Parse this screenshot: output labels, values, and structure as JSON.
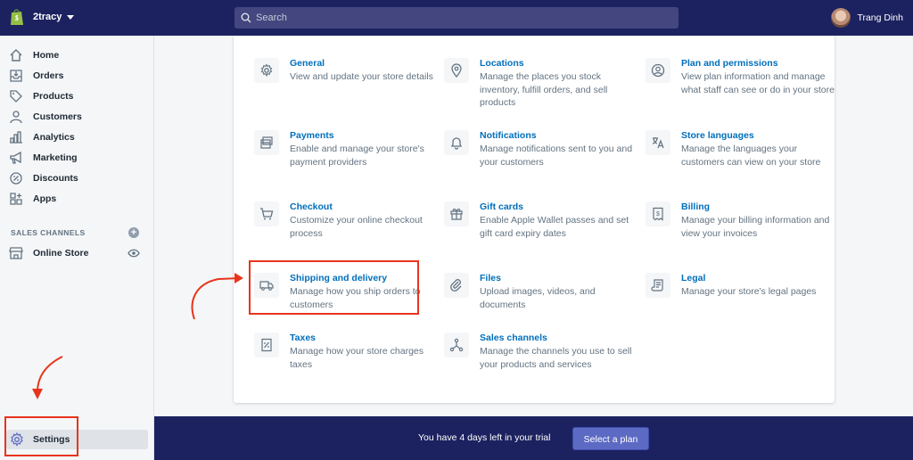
{
  "topbar": {
    "store_name": "2tracy",
    "search_placeholder": "Search",
    "user_name": "Trang Dinh"
  },
  "sidebar": {
    "items": [
      {
        "label": "Home",
        "icon": "home-icon"
      },
      {
        "label": "Orders",
        "icon": "orders-icon"
      },
      {
        "label": "Products",
        "icon": "tag-icon"
      },
      {
        "label": "Customers",
        "icon": "person-icon"
      },
      {
        "label": "Analytics",
        "icon": "bar-chart-icon"
      },
      {
        "label": "Marketing",
        "icon": "megaphone-icon"
      },
      {
        "label": "Discounts",
        "icon": "discount-icon"
      },
      {
        "label": "Apps",
        "icon": "apps-icon"
      }
    ],
    "sales_channels_heading": "SALES CHANNELS",
    "online_store_label": "Online Store",
    "settings_label": "Settings"
  },
  "settings": [
    {
      "title": "General",
      "desc": "View and update your store details",
      "icon": "gear-icon"
    },
    {
      "title": "Locations",
      "desc": "Manage the places you stock inventory, fulfill orders, and sell products",
      "icon": "location-pin-icon"
    },
    {
      "title": "Plan and permissions",
      "desc": "View plan information and manage what staff can see or do in your store",
      "icon": "user-circle-icon"
    },
    {
      "title": "Payments",
      "desc": "Enable and manage your store's payment providers",
      "icon": "credit-card-icon"
    },
    {
      "title": "Notifications",
      "desc": "Manage notifications sent to you and your customers",
      "icon": "bell-icon"
    },
    {
      "title": "Store languages",
      "desc": "Manage the languages your customers can view on your store",
      "icon": "translate-icon"
    },
    {
      "title": "Checkout",
      "desc": "Customize your online checkout process",
      "icon": "cart-icon"
    },
    {
      "title": "Gift cards",
      "desc": "Enable Apple Wallet passes and set gift card expiry dates",
      "icon": "gift-icon"
    },
    {
      "title": "Billing",
      "desc": "Manage your billing information and view your invoices",
      "icon": "invoice-icon"
    },
    {
      "title": "Shipping and delivery",
      "desc": "Manage how you ship orders to customers",
      "icon": "truck-icon"
    },
    {
      "title": "Files",
      "desc": "Upload images, videos, and documents",
      "icon": "paperclip-icon"
    },
    {
      "title": "Legal",
      "desc": "Manage your store's legal pages",
      "icon": "scroll-icon"
    },
    {
      "title": "Taxes",
      "desc": "Manage how your store charges taxes",
      "icon": "tax-receipt-icon"
    },
    {
      "title": "Sales channels",
      "desc": "Manage the channels you use to sell your products and services",
      "icon": "channels-icon"
    }
  ],
  "trial": {
    "text": "You have 4 days left in your trial",
    "button": "Select a plan"
  },
  "colors": {
    "topbar": "#1c2260",
    "link": "#006fbb",
    "annotation": "#e8341c",
    "button": "#5c6ac4"
  }
}
